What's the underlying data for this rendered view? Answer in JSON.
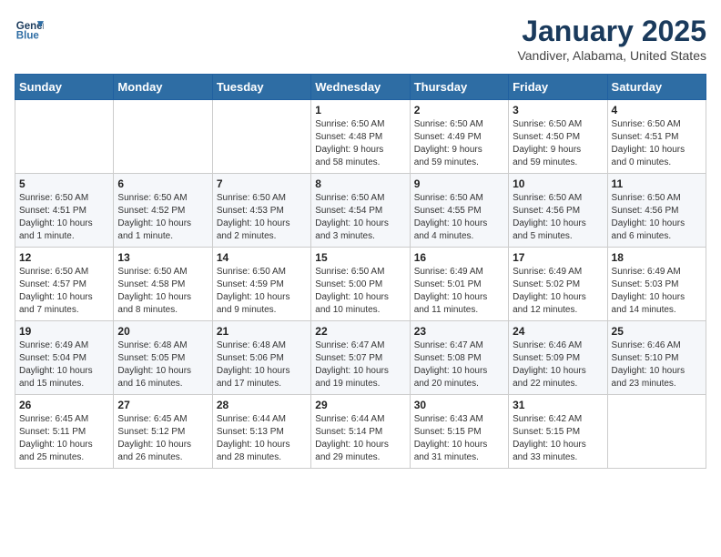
{
  "header": {
    "logo_line1": "General",
    "logo_line2": "Blue",
    "month": "January 2025",
    "location": "Vandiver, Alabama, United States"
  },
  "days_of_week": [
    "Sunday",
    "Monday",
    "Tuesday",
    "Wednesday",
    "Thursday",
    "Friday",
    "Saturday"
  ],
  "weeks": [
    [
      {
        "day": "",
        "info": ""
      },
      {
        "day": "",
        "info": ""
      },
      {
        "day": "",
        "info": ""
      },
      {
        "day": "1",
        "info": "Sunrise: 6:50 AM\nSunset: 4:48 PM\nDaylight: 9 hours\nand 58 minutes."
      },
      {
        "day": "2",
        "info": "Sunrise: 6:50 AM\nSunset: 4:49 PM\nDaylight: 9 hours\nand 59 minutes."
      },
      {
        "day": "3",
        "info": "Sunrise: 6:50 AM\nSunset: 4:50 PM\nDaylight: 9 hours\nand 59 minutes."
      },
      {
        "day": "4",
        "info": "Sunrise: 6:50 AM\nSunset: 4:51 PM\nDaylight: 10 hours\nand 0 minutes."
      }
    ],
    [
      {
        "day": "5",
        "info": "Sunrise: 6:50 AM\nSunset: 4:51 PM\nDaylight: 10 hours\nand 1 minute."
      },
      {
        "day": "6",
        "info": "Sunrise: 6:50 AM\nSunset: 4:52 PM\nDaylight: 10 hours\nand 1 minute."
      },
      {
        "day": "7",
        "info": "Sunrise: 6:50 AM\nSunset: 4:53 PM\nDaylight: 10 hours\nand 2 minutes."
      },
      {
        "day": "8",
        "info": "Sunrise: 6:50 AM\nSunset: 4:54 PM\nDaylight: 10 hours\nand 3 minutes."
      },
      {
        "day": "9",
        "info": "Sunrise: 6:50 AM\nSunset: 4:55 PM\nDaylight: 10 hours\nand 4 minutes."
      },
      {
        "day": "10",
        "info": "Sunrise: 6:50 AM\nSunset: 4:56 PM\nDaylight: 10 hours\nand 5 minutes."
      },
      {
        "day": "11",
        "info": "Sunrise: 6:50 AM\nSunset: 4:56 PM\nDaylight: 10 hours\nand 6 minutes."
      }
    ],
    [
      {
        "day": "12",
        "info": "Sunrise: 6:50 AM\nSunset: 4:57 PM\nDaylight: 10 hours\nand 7 minutes."
      },
      {
        "day": "13",
        "info": "Sunrise: 6:50 AM\nSunset: 4:58 PM\nDaylight: 10 hours\nand 8 minutes."
      },
      {
        "day": "14",
        "info": "Sunrise: 6:50 AM\nSunset: 4:59 PM\nDaylight: 10 hours\nand 9 minutes."
      },
      {
        "day": "15",
        "info": "Sunrise: 6:50 AM\nSunset: 5:00 PM\nDaylight: 10 hours\nand 10 minutes."
      },
      {
        "day": "16",
        "info": "Sunrise: 6:49 AM\nSunset: 5:01 PM\nDaylight: 10 hours\nand 11 minutes."
      },
      {
        "day": "17",
        "info": "Sunrise: 6:49 AM\nSunset: 5:02 PM\nDaylight: 10 hours\nand 12 minutes."
      },
      {
        "day": "18",
        "info": "Sunrise: 6:49 AM\nSunset: 5:03 PM\nDaylight: 10 hours\nand 14 minutes."
      }
    ],
    [
      {
        "day": "19",
        "info": "Sunrise: 6:49 AM\nSunset: 5:04 PM\nDaylight: 10 hours\nand 15 minutes."
      },
      {
        "day": "20",
        "info": "Sunrise: 6:48 AM\nSunset: 5:05 PM\nDaylight: 10 hours\nand 16 minutes."
      },
      {
        "day": "21",
        "info": "Sunrise: 6:48 AM\nSunset: 5:06 PM\nDaylight: 10 hours\nand 17 minutes."
      },
      {
        "day": "22",
        "info": "Sunrise: 6:47 AM\nSunset: 5:07 PM\nDaylight: 10 hours\nand 19 minutes."
      },
      {
        "day": "23",
        "info": "Sunrise: 6:47 AM\nSunset: 5:08 PM\nDaylight: 10 hours\nand 20 minutes."
      },
      {
        "day": "24",
        "info": "Sunrise: 6:46 AM\nSunset: 5:09 PM\nDaylight: 10 hours\nand 22 minutes."
      },
      {
        "day": "25",
        "info": "Sunrise: 6:46 AM\nSunset: 5:10 PM\nDaylight: 10 hours\nand 23 minutes."
      }
    ],
    [
      {
        "day": "26",
        "info": "Sunrise: 6:45 AM\nSunset: 5:11 PM\nDaylight: 10 hours\nand 25 minutes."
      },
      {
        "day": "27",
        "info": "Sunrise: 6:45 AM\nSunset: 5:12 PM\nDaylight: 10 hours\nand 26 minutes."
      },
      {
        "day": "28",
        "info": "Sunrise: 6:44 AM\nSunset: 5:13 PM\nDaylight: 10 hours\nand 28 minutes."
      },
      {
        "day": "29",
        "info": "Sunrise: 6:44 AM\nSunset: 5:14 PM\nDaylight: 10 hours\nand 29 minutes."
      },
      {
        "day": "30",
        "info": "Sunrise: 6:43 AM\nSunset: 5:15 PM\nDaylight: 10 hours\nand 31 minutes."
      },
      {
        "day": "31",
        "info": "Sunrise: 6:42 AM\nSunset: 5:15 PM\nDaylight: 10 hours\nand 33 minutes."
      },
      {
        "day": "",
        "info": ""
      }
    ]
  ]
}
